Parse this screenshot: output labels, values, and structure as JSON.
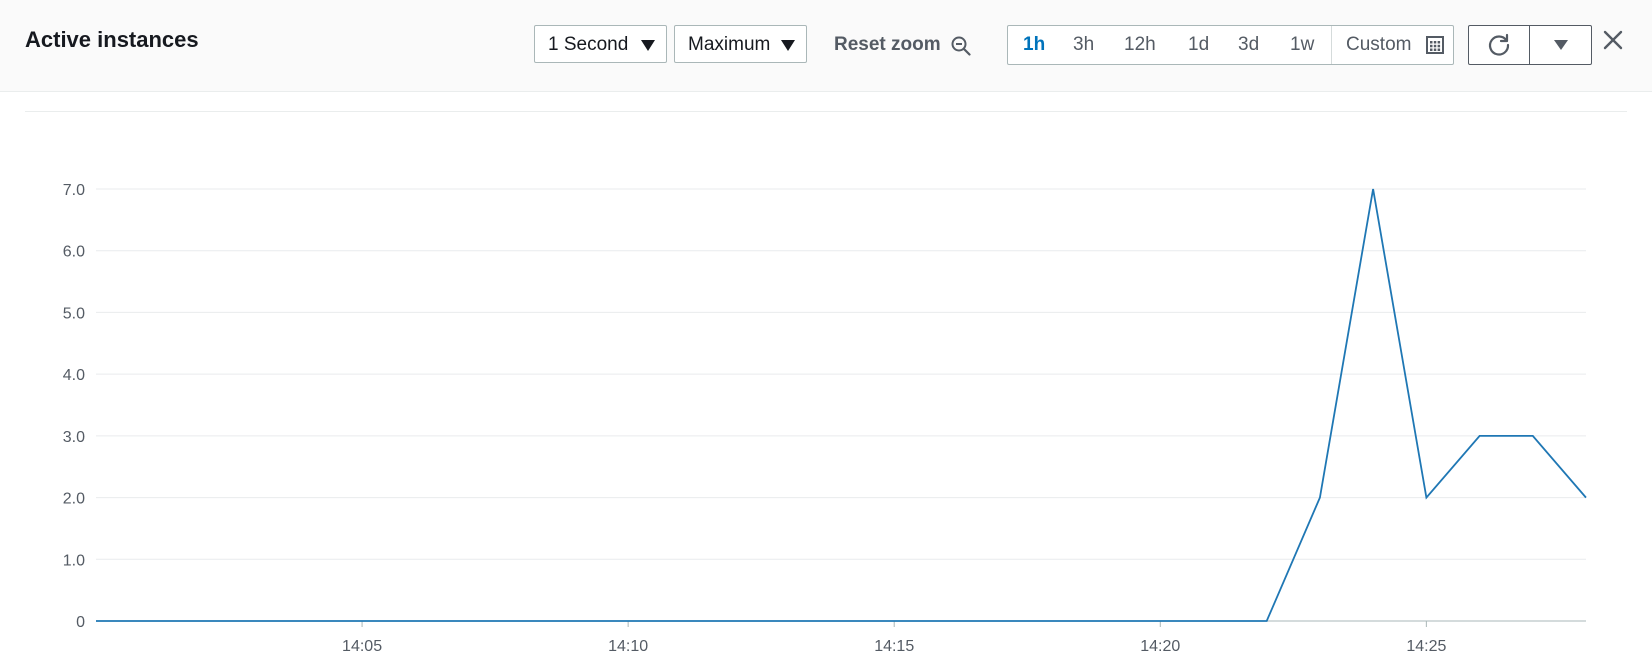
{
  "header": {
    "title": "Active instances",
    "period_select": "1 Second",
    "statistic_select": "Maximum",
    "reset_zoom": "Reset zoom",
    "time_ranges": [
      {
        "label": "1h",
        "active": true
      },
      {
        "label": "3h",
        "active": false
      },
      {
        "label": "12h",
        "active": false
      },
      {
        "label": "1d",
        "active": false
      },
      {
        "label": "3d",
        "active": false
      },
      {
        "label": "1w",
        "active": false
      }
    ],
    "custom_label": "Custom"
  },
  "colors": {
    "line": "#1f77b4",
    "accent": "#0073bb",
    "grid": "#e9ebed"
  },
  "chart_data": {
    "type": "line",
    "title": "",
    "xlabel": "",
    "ylabel": "",
    "x_ticks": [
      "14:05",
      "14:10",
      "14:15",
      "14:20",
      "14:25"
    ],
    "y_ticks": [
      "0",
      "1.0",
      "2.0",
      "3.0",
      "4.0",
      "5.0",
      "6.0",
      "7.0"
    ],
    "xlim": [
      "14:00",
      "14:28"
    ],
    "ylim": [
      0,
      7
    ],
    "grid": true,
    "series": [
      {
        "x": [
          "14:00",
          "14:22",
          "14:23",
          "14:24",
          "14:25",
          "14:26",
          "14:27",
          "14:28"
        ],
        "values": [
          0,
          0,
          2,
          7,
          2,
          3,
          3,
          2
        ]
      }
    ]
  }
}
